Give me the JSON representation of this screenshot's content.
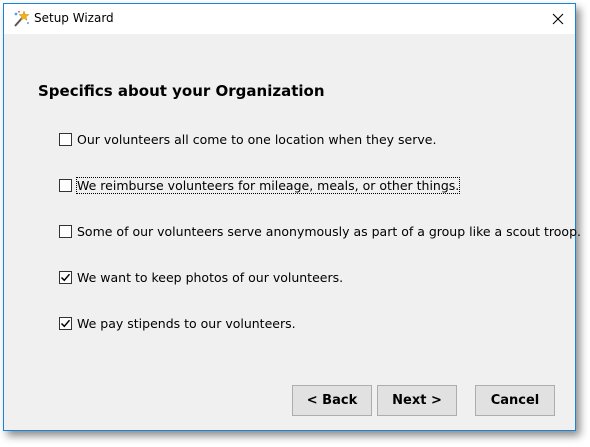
{
  "window": {
    "title": "Setup Wizard",
    "icon": "wand-sparkle-icon",
    "accent": "#1883d7"
  },
  "heading": "Specifics about your Organization",
  "options": [
    {
      "label": "Our volunteers all come to one location when they serve.",
      "checked": false
    },
    {
      "label": "We reimburse volunteers for mileage, meals, or other things.",
      "checked": false,
      "focused": true
    },
    {
      "label": "Some of our volunteers serve anonymously as part of a group like a scout troop.",
      "checked": false
    },
    {
      "label": "We want to keep photos of our volunteers.",
      "checked": true
    },
    {
      "label": "We pay stipends to our volunteers.",
      "checked": true
    }
  ],
  "buttons": {
    "back": "< Back",
    "next": "Next >",
    "cancel": "Cancel"
  }
}
